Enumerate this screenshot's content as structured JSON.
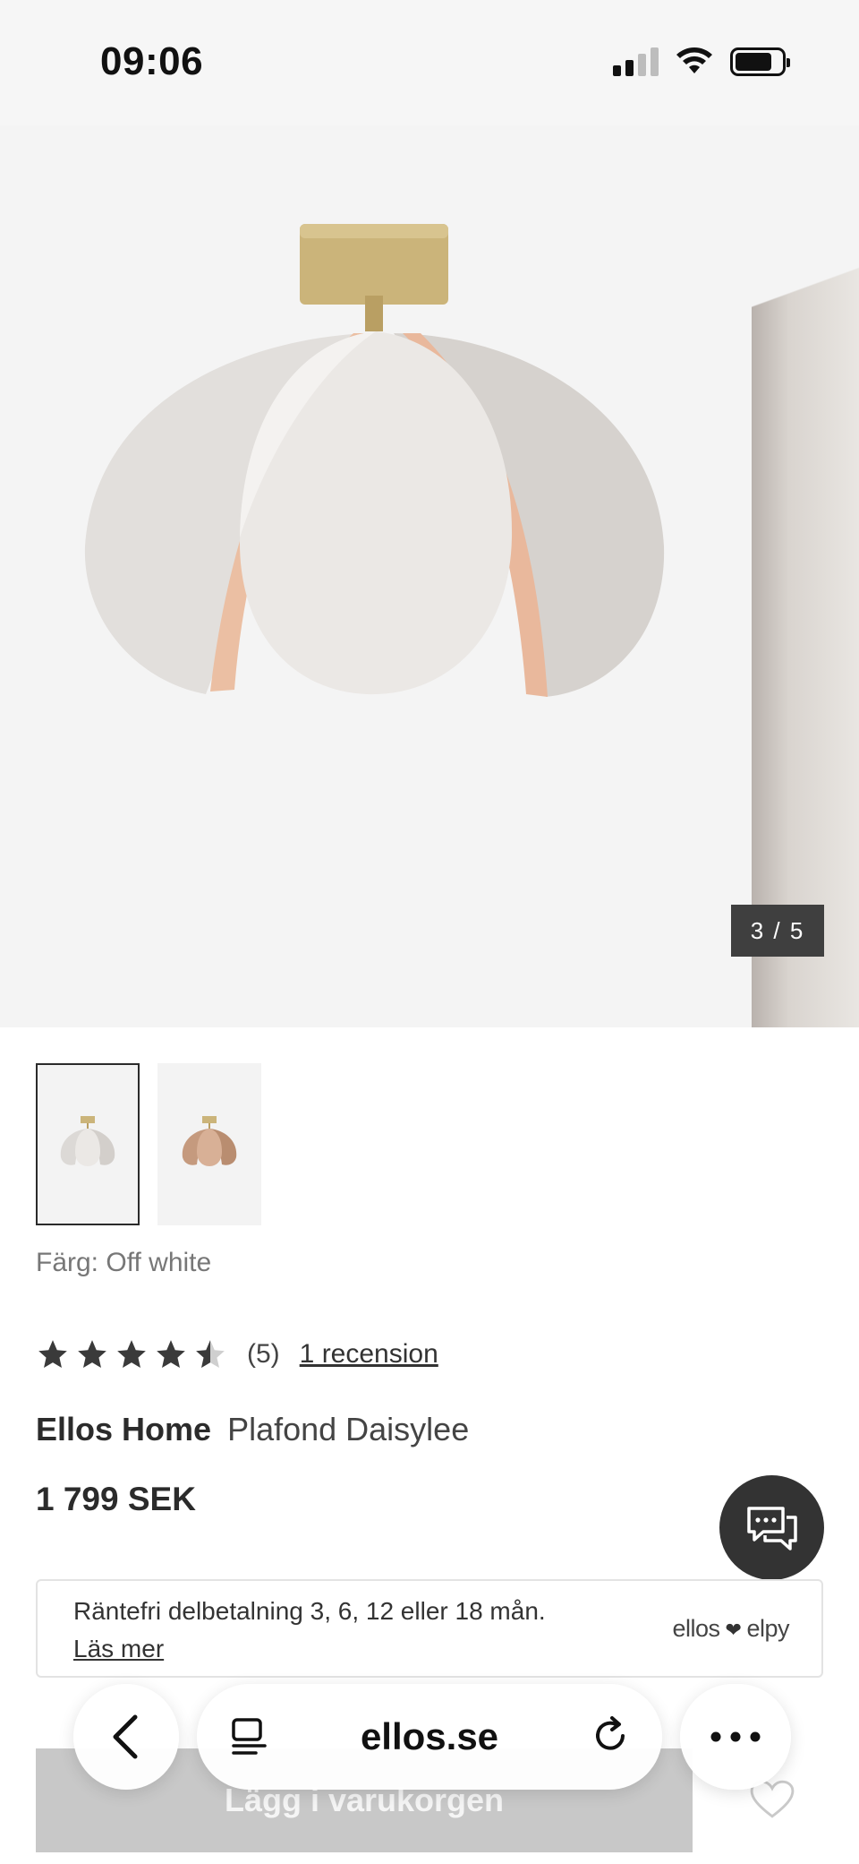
{
  "status_bar": {
    "time": "09:06"
  },
  "gallery": {
    "counter": "3 / 5"
  },
  "thumbnails": [
    {
      "name": "off-white",
      "active": true
    },
    {
      "name": "rose",
      "active": false
    }
  ],
  "color": {
    "label": "Färg: Off white"
  },
  "rating": {
    "value": 4.5,
    "max": 5,
    "count_text": "(5)",
    "reviews_link": "1 recension"
  },
  "product": {
    "brand": "Ellos Home",
    "name": "Plafond Daisylee",
    "price": "1 799 SEK"
  },
  "payment": {
    "info": "Räntefri delbetalning 3, 6, 12 eller 18 mån.",
    "link": "Läs mer",
    "logo_text": "ellos",
    "logo_suffix": "elpy"
  },
  "cart": {
    "label": "Lägg i varukorgen"
  },
  "browser": {
    "url": "ellos.se"
  },
  "colors": {
    "accent_dark": "#333333",
    "lamp_gold": "#c8b27a",
    "lamp_petal": "#e7e4e1",
    "lamp_pink": "#e9b89c"
  }
}
